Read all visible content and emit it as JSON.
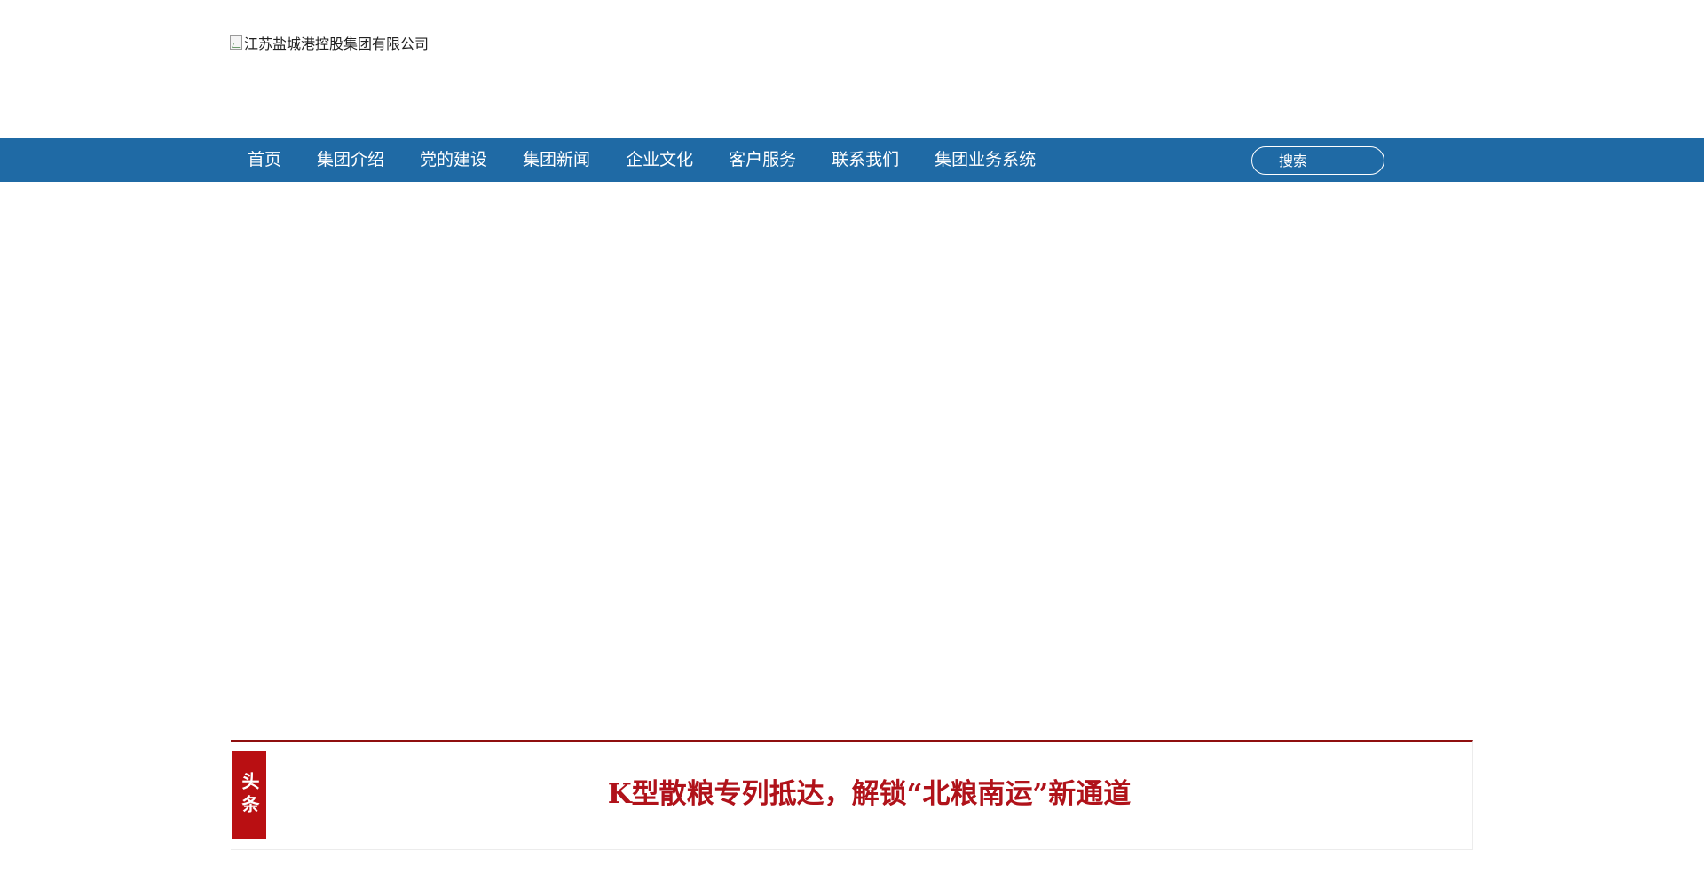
{
  "header": {
    "logo_alt": "江苏盐城港控股集团有限公司"
  },
  "nav": {
    "items": [
      {
        "label": "首页"
      },
      {
        "label": "集团介绍"
      },
      {
        "label": "党的建设"
      },
      {
        "label": "集团新闻"
      },
      {
        "label": "企业文化"
      },
      {
        "label": "客户服务"
      },
      {
        "label": "联系我们"
      },
      {
        "label": "集团业务系统"
      }
    ],
    "search": {
      "placeholder": "搜索",
      "value": ""
    }
  },
  "headline": {
    "tag": "头条",
    "title": "K型散粮专列抵达，解锁“北粮南运”新通道"
  },
  "colors": {
    "nav_bg": "#1f6aa5",
    "headline_accent": "#b90f12",
    "headline_title": "#b0121a"
  },
  "icons": {
    "logo": "broken-image-icon"
  }
}
